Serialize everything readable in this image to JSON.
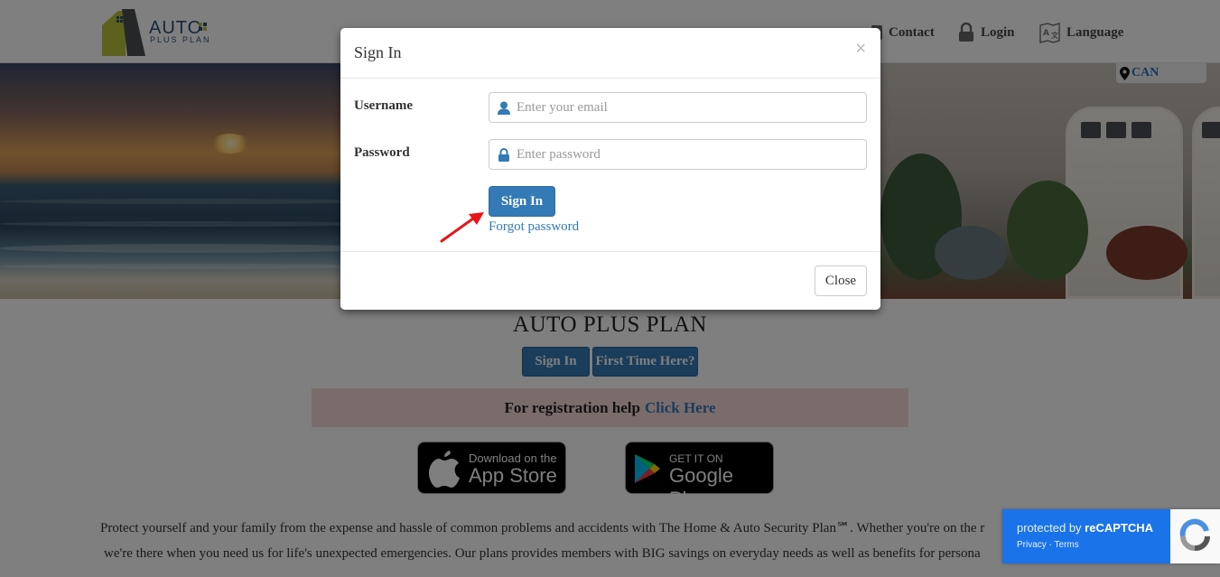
{
  "logo": {
    "word_top": "AUTO",
    "word_bottom": "PLUS PLAN"
  },
  "nav": {
    "contact_label": "Contact",
    "login_label": "Login",
    "language_label": "Language"
  },
  "country": {
    "code": "CAN"
  },
  "page": {
    "title": "AUTO PLUS PLAN",
    "signin_label": "Sign In",
    "first_time_label": "First Time Here?",
    "reg_help_text": "For registration help",
    "reg_help_link": "Click Here",
    "app_store": {
      "small": "Download on the",
      "big": "App Store"
    },
    "google_play": {
      "small": "GET IT ON",
      "big": "Google Play"
    },
    "description_line1": "Protect yourself and your family from the expense and hassle of common problems and accidents with The Home & Auto Security Plan℠. Whether you're on the r",
    "description_line2": "we're there when you need us for life's unexpected emergencies. Our plans provides members with BIG savings on everyday needs as well as benefits for persona"
  },
  "modal": {
    "title": "Sign In",
    "close_x": "×",
    "username_label": "Username",
    "username_placeholder": "Enter your email",
    "password_label": "Password",
    "password_placeholder": "Enter password",
    "signin_button": "Sign In",
    "forgot_link": "Forgot password",
    "close_button": "Close"
  },
  "recaptcha": {
    "protected_prefix": "protected by",
    "brand": "reCAPTCHA",
    "privacy": "Privacy",
    "separator": "·",
    "terms": "Terms"
  },
  "colors": {
    "primary": "#337ab7",
    "reg_help_bg": "#f7d9d9",
    "recaptcha_blue": "#1a73e8",
    "arrow_red": "#e8141a"
  }
}
